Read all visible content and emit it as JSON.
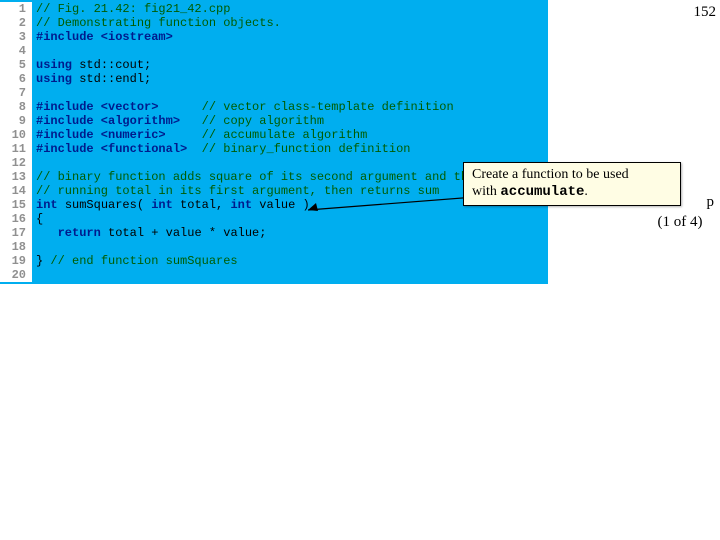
{
  "page_number": "152",
  "side_label_line1": "p",
  "side_label_line2": "(1 of 4)",
  "callout": {
    "line1": "Create a function to be used",
    "line2_prefix": "with ",
    "line2_code": "accumulate",
    "line2_suffix": "."
  },
  "code": [
    {
      "n": "1",
      "segs": [
        {
          "c": "cm",
          "t": "// Fig. 21.42: fig21_42.cpp"
        }
      ]
    },
    {
      "n": "2",
      "segs": [
        {
          "c": "cm",
          "t": "// Demonstrating function objects."
        }
      ]
    },
    {
      "n": "3",
      "segs": [
        {
          "c": "kw",
          "t": "#include <iostream>"
        }
      ]
    },
    {
      "n": "4",
      "segs": [
        {
          "c": "",
          "t": ""
        }
      ]
    },
    {
      "n": "5",
      "segs": [
        {
          "c": "kw",
          "t": "using "
        },
        {
          "c": "",
          "t": "std::cout;"
        }
      ]
    },
    {
      "n": "6",
      "segs": [
        {
          "c": "kw",
          "t": "using "
        },
        {
          "c": "",
          "t": "std::endl;"
        }
      ]
    },
    {
      "n": "7",
      "segs": [
        {
          "c": "",
          "t": ""
        }
      ]
    },
    {
      "n": "8",
      "segs": [
        {
          "c": "kw",
          "t": "#include <vector>      "
        },
        {
          "c": "cm",
          "t": "// vector class-template definition"
        }
      ]
    },
    {
      "n": "9",
      "segs": [
        {
          "c": "kw",
          "t": "#include <algorithm>   "
        },
        {
          "c": "cm",
          "t": "// copy algorithm"
        }
      ]
    },
    {
      "n": "10",
      "segs": [
        {
          "c": "kw",
          "t": "#include <numeric>     "
        },
        {
          "c": "cm",
          "t": "// accumulate algorithm"
        }
      ]
    },
    {
      "n": "11",
      "segs": [
        {
          "c": "kw",
          "t": "#include <functional>  "
        },
        {
          "c": "cm",
          "t": "// binary_function definition"
        }
      ]
    },
    {
      "n": "12",
      "segs": [
        {
          "c": "",
          "t": ""
        }
      ]
    },
    {
      "n": "13",
      "segs": [
        {
          "c": "cm",
          "t": "// binary function adds square of its second argument and the"
        }
      ]
    },
    {
      "n": "14",
      "segs": [
        {
          "c": "cm",
          "t": "// running total in its first argument, then returns sum"
        }
      ]
    },
    {
      "n": "15",
      "segs": [
        {
          "c": "kw",
          "t": "int "
        },
        {
          "c": "",
          "t": "sumSquares( "
        },
        {
          "c": "kw",
          "t": "int"
        },
        {
          "c": "",
          "t": " total, "
        },
        {
          "c": "kw",
          "t": "int"
        },
        {
          "c": "",
          "t": " value )"
        }
      ]
    },
    {
      "n": "16",
      "segs": [
        {
          "c": "",
          "t": "{"
        }
      ]
    },
    {
      "n": "17",
      "segs": [
        {
          "c": "",
          "t": "   "
        },
        {
          "c": "kw",
          "t": "return"
        },
        {
          "c": "",
          "t": " total + value * value;"
        }
      ]
    },
    {
      "n": "18",
      "segs": [
        {
          "c": "",
          "t": ""
        }
      ]
    },
    {
      "n": "19",
      "segs": [
        {
          "c": "",
          "t": "} "
        },
        {
          "c": "cm",
          "t": "// end function sumSquares"
        }
      ]
    },
    {
      "n": "20",
      "segs": [
        {
          "c": "",
          "t": ""
        }
      ]
    }
  ]
}
